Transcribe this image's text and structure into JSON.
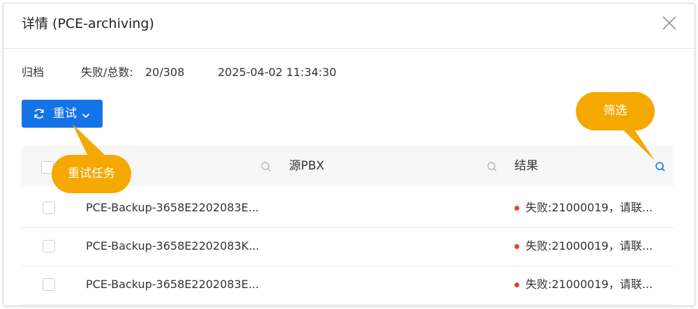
{
  "dialog": {
    "title": "详情 (PCE-archiving)"
  },
  "info": {
    "type": "归档",
    "failed_total_label": "失败/总数:",
    "failed_total_value": "20/308",
    "timestamp": "2025-04-02 11:34:30"
  },
  "toolbar": {
    "retry_label": "重试"
  },
  "table": {
    "columns": [
      "",
      "源PBX",
      "结果"
    ],
    "rows": [
      {
        "name": "PCE-Backup-3658E2202083E...",
        "result": "失败:21000019，请联..."
      },
      {
        "name": "PCE-Backup-3658E2202083K...",
        "result": "失败:21000019，请联..."
      },
      {
        "name": "PCE-Backup-3658E2202083E...",
        "result": "失败:21000019，请联..."
      }
    ]
  },
  "callouts": {
    "retry_task": "重试任务",
    "filter": "筛选"
  },
  "colors": {
    "primary": "#1473e6",
    "callout": "#f5a800",
    "error_dot": "#e0442f"
  }
}
